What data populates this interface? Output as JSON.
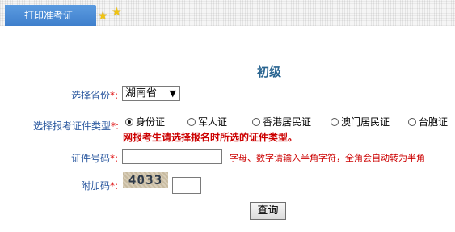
{
  "header": {
    "tab_label": "打印准考证",
    "accent": "#4a8ad6"
  },
  "form": {
    "title": "初级",
    "province": {
      "label": "选择省份",
      "required_mark": "*:",
      "selected": "湖南省"
    },
    "id_type": {
      "label": "选择报考证件类型",
      "required_mark": "*:",
      "options": [
        "身份证",
        "军人证",
        "香港居民证",
        "澳门居民证",
        "台胞证"
      ],
      "selected_index": 0,
      "warning": "网报考生请选择报名时所选的证件类型。"
    },
    "id_number": {
      "label": "证件号码",
      "required_mark": "*:",
      "value": "",
      "hint": "字母、数字请输入半角字符，全角会自动转为半角"
    },
    "captcha": {
      "label": "附加码",
      "required_mark": "*:",
      "image_text": "4033",
      "value": ""
    },
    "submit_label": "查询"
  }
}
